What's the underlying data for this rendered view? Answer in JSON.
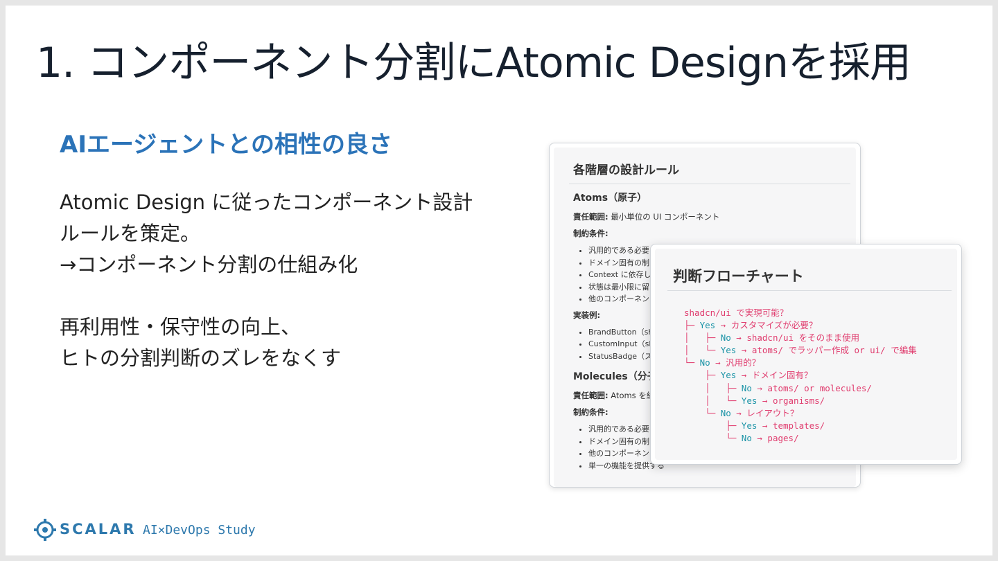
{
  "slide": {
    "title": "1. コンポーネント分割にAtomic Designを採用",
    "subtitle": "AIエージェントとの相性の良さ",
    "body": {
      "p1_line1": "Atomic Design に従ったコンポーネント設計",
      "p1_line2": "ルールを策定。",
      "p1_line3": "→コンポーネント分割の仕組み化",
      "p2_line1": "再利用性・保守性の向上、",
      "p2_line2": "ヒトの分割判断のズレをなくす"
    }
  },
  "back_card": {
    "heading": "各階層の設計ルール",
    "atoms_title": "Atoms（原子）",
    "atoms_scope_label": "責任範囲:",
    "atoms_scope_value": "最小単位の UI コンポーネント",
    "atoms_constraints_label": "制約条件:",
    "atoms_constraints": [
      "汎用的である必要",
      "ドメイン固有の制",
      "Context に依存し",
      "状態は最小限に留",
      "他のコンポーネン"
    ],
    "examples_label": "実装例:",
    "examples": [
      "BrandButton（sh",
      "CustomInput（sh",
      "StatusBadge（ス"
    ],
    "molecules_title": "Molecules（分子）",
    "molecules_scope_label": "責任範囲:",
    "molecules_scope_value": "Atoms を組",
    "molecules_constraints_label": "制約条件:",
    "molecules_constraints": [
      "汎用的である必要",
      "ドメイン固有の制",
      "他のコンポーネント（主に Atoms）に依存可能",
      "単一の機能を提供する"
    ]
  },
  "front_card": {
    "heading": "判断フローチャート",
    "flow": [
      {
        "indent": "",
        "kw": "",
        "rest": "shadcn/ui で実現可能？"
      },
      {
        "indent": "├─ ",
        "kw": "Yes",
        "rest": " → カスタマイズが必要？"
      },
      {
        "indent": "│   ├─ ",
        "kw": "No",
        "rest": " → shadcn/ui をそのまま使用"
      },
      {
        "indent": "│   └─ ",
        "kw": "Yes",
        "rest": " → atoms/ でラッパー作成 or ui/ で編集"
      },
      {
        "indent": "└─ ",
        "kw": "No",
        "rest": " → 汎用的？"
      },
      {
        "indent": "    ├─ ",
        "kw": "Yes",
        "rest": " → ドメイン固有？"
      },
      {
        "indent": "    │   ├─ ",
        "kw": "No",
        "rest": " → atoms/ or molecules/"
      },
      {
        "indent": "    │   └─ ",
        "kw": "Yes",
        "rest": " → organisms/"
      },
      {
        "indent": "    └─ ",
        "kw": "No",
        "rest": " → レイアウト？"
      },
      {
        "indent": "        ├─ ",
        "kw": "Yes",
        "rest": " → templates/"
      },
      {
        "indent": "        └─ ",
        "kw": "No",
        "rest": " → pages/"
      }
    ]
  },
  "footer": {
    "brand": "SCALAR",
    "study": "AI×DevOps Study"
  },
  "colors": {
    "title": "#16202e",
    "subtitle": "#2b73b8",
    "code_text": "#e03c6e",
    "code_keyword": "#1a93a6",
    "brand": "#2e79ad"
  },
  "icons": {
    "logo": "scalar-logo-icon"
  }
}
